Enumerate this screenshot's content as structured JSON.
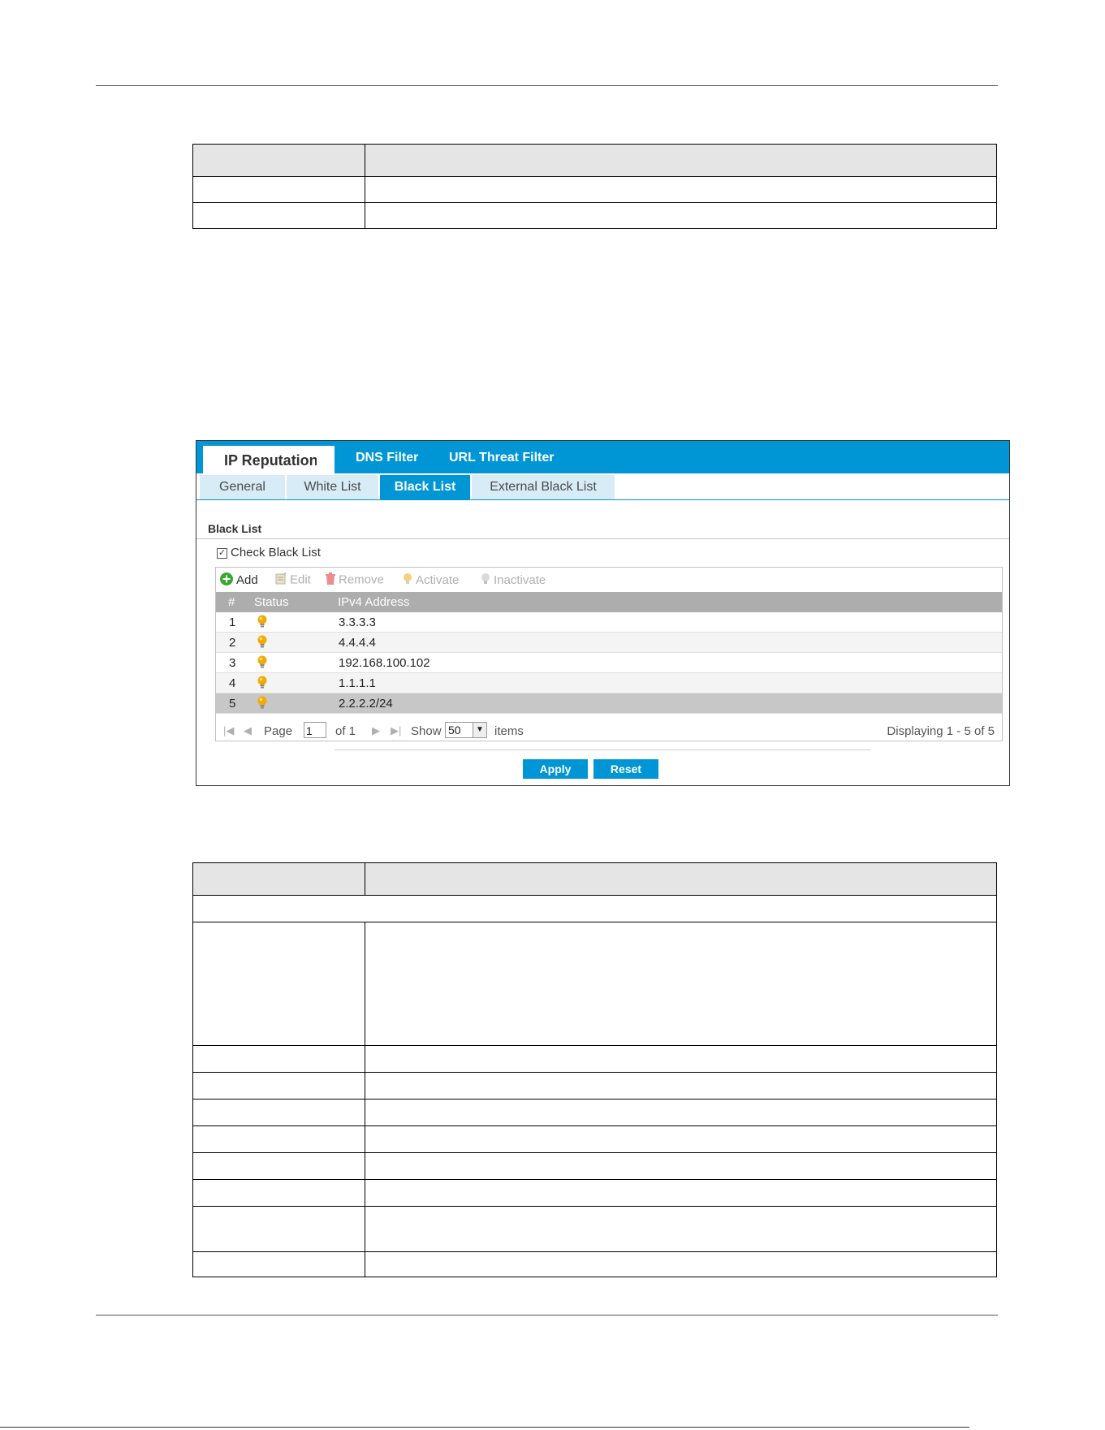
{
  "ui": {
    "main_tabs": [
      "IP Reputation",
      "DNS Filter",
      "URL Threat Filter"
    ],
    "sub_tabs": [
      "General",
      "White List",
      "Black List",
      "External Black List"
    ],
    "section_title": "Black List",
    "check_label": "Check Black List",
    "check_mark": "✓",
    "toolbar": {
      "add": "Add",
      "edit": "Edit",
      "remove": "Remove",
      "activate": "Activate",
      "inactivate": "Inactivate"
    },
    "columns": [
      "#",
      "Status",
      "IPv4 Address"
    ],
    "rows": [
      {
        "num": "1",
        "ip": "3.3.3.3"
      },
      {
        "num": "2",
        "ip": "4.4.4.4"
      },
      {
        "num": "3",
        "ip": "192.168.100.102"
      },
      {
        "num": "4",
        "ip": "1.1.1.1"
      },
      {
        "num": "5",
        "ip": "2.2.2.2/24"
      }
    ],
    "pager": {
      "page_label": "Page",
      "page_value": "1",
      "of_label": "of 1",
      "show_label": "Show",
      "show_value": "50",
      "items_label": "items",
      "displaying": "Displaying 1 - 5 of 5"
    },
    "apply_label": "Apply",
    "reset_label": "Reset"
  },
  "colors": {
    "accent": "#0096d6",
    "header_gray": "#adadad",
    "bulb_active": "#f5a800",
    "add_green": "#3aa82e"
  }
}
